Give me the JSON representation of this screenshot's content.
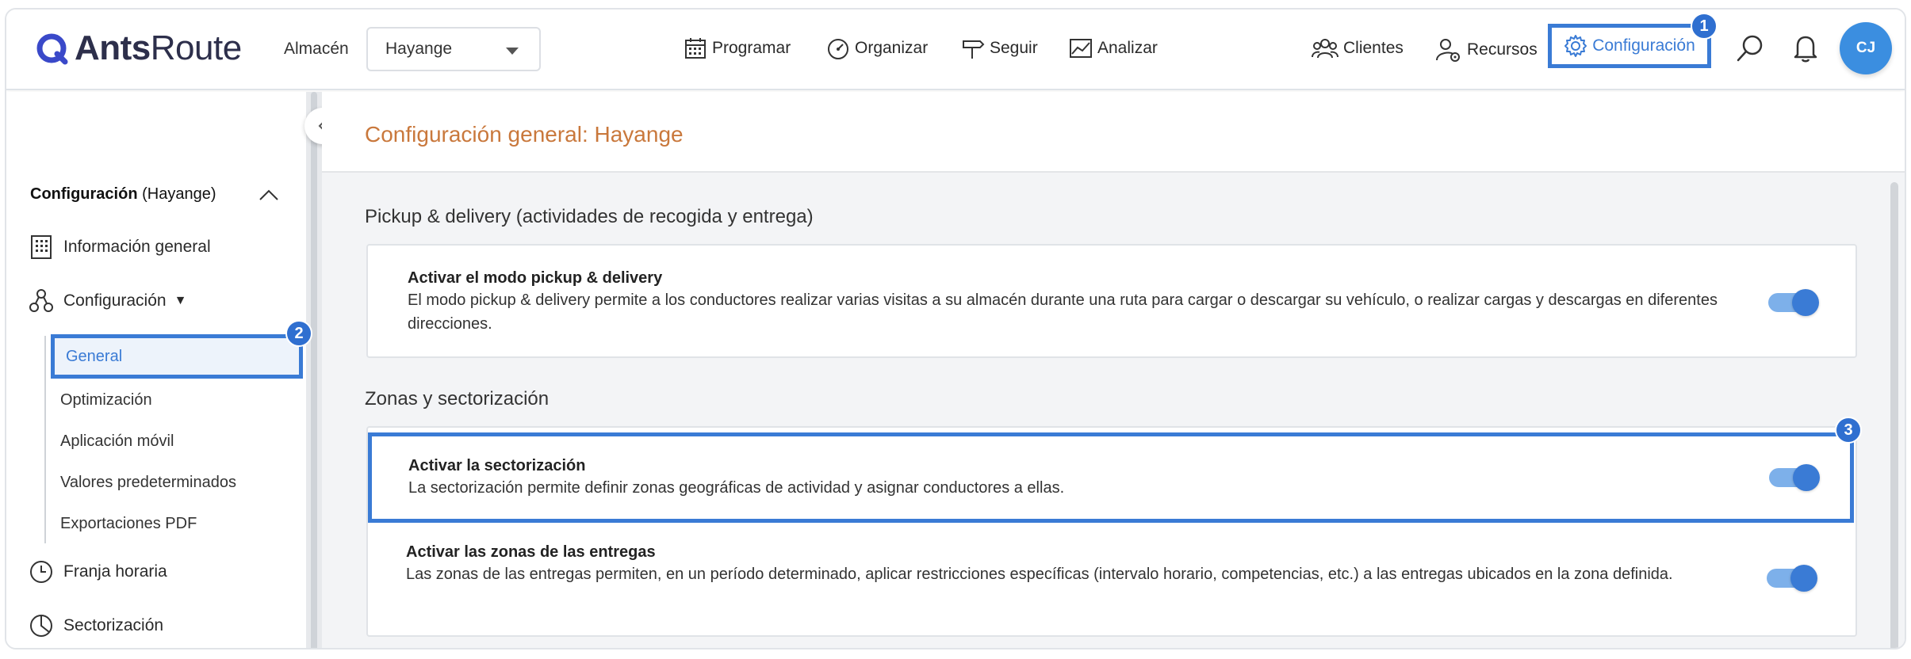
{
  "header": {
    "logo_bold": "Ants",
    "logo_rest": "Route",
    "store_label": "Almacén",
    "store_value": "Hayange",
    "nav": {
      "programar": "Programar",
      "organizar": "Organizar",
      "seguir": "Seguir",
      "analizar": "Analizar",
      "clientes": "Clientes",
      "recursos": "Recursos",
      "configuracion": "Configuración"
    },
    "avatar_initials": "CJ"
  },
  "badges": {
    "one": "1",
    "two": "2",
    "three": "3"
  },
  "sidebar": {
    "title_bold": "Configuración",
    "title_rest": " (Hayange)",
    "items": {
      "info": "Información general",
      "config": "Configuración",
      "franja": "Franja horaria",
      "sector": "Sectorización"
    },
    "sub_items": {
      "general": "General",
      "optim": "Optimización",
      "app": "Aplicación móvil",
      "valores": "Valores predeterminados",
      "export": "Exportaciones PDF"
    }
  },
  "main": {
    "page_title": "Configuración general: Hayange",
    "section1": "Pickup & delivery (actividades de recogida y entrega)",
    "card1": {
      "title": "Activar el modo pickup & delivery",
      "desc": "El modo pickup & delivery permite a los conductores realizar varias visitas a su almacén durante una ruta para cargar o descargar su vehículo, o realizar cargas y descargas en diferentes direcciones.",
      "enabled": true
    },
    "section2": "Zonas y sectorización",
    "card2": {
      "title": "Activar la sectorización",
      "desc": "La sectorización permite definir zonas geográficas de actividad y asignar conductores a ellas.",
      "enabled": true
    },
    "card3": {
      "title": "Activar las zonas de las entregas",
      "desc": "Las zonas de las entregas permiten, en un período determinado, aplicar restricciones específicas (intervalo horario, competencias, etc.) a las entregas ubicados en la zona definida.",
      "enabled": true
    }
  },
  "colors": {
    "accent": "#3a7bd5",
    "title_orange": "#c9783c",
    "toggle_track": "#7db0ea"
  }
}
